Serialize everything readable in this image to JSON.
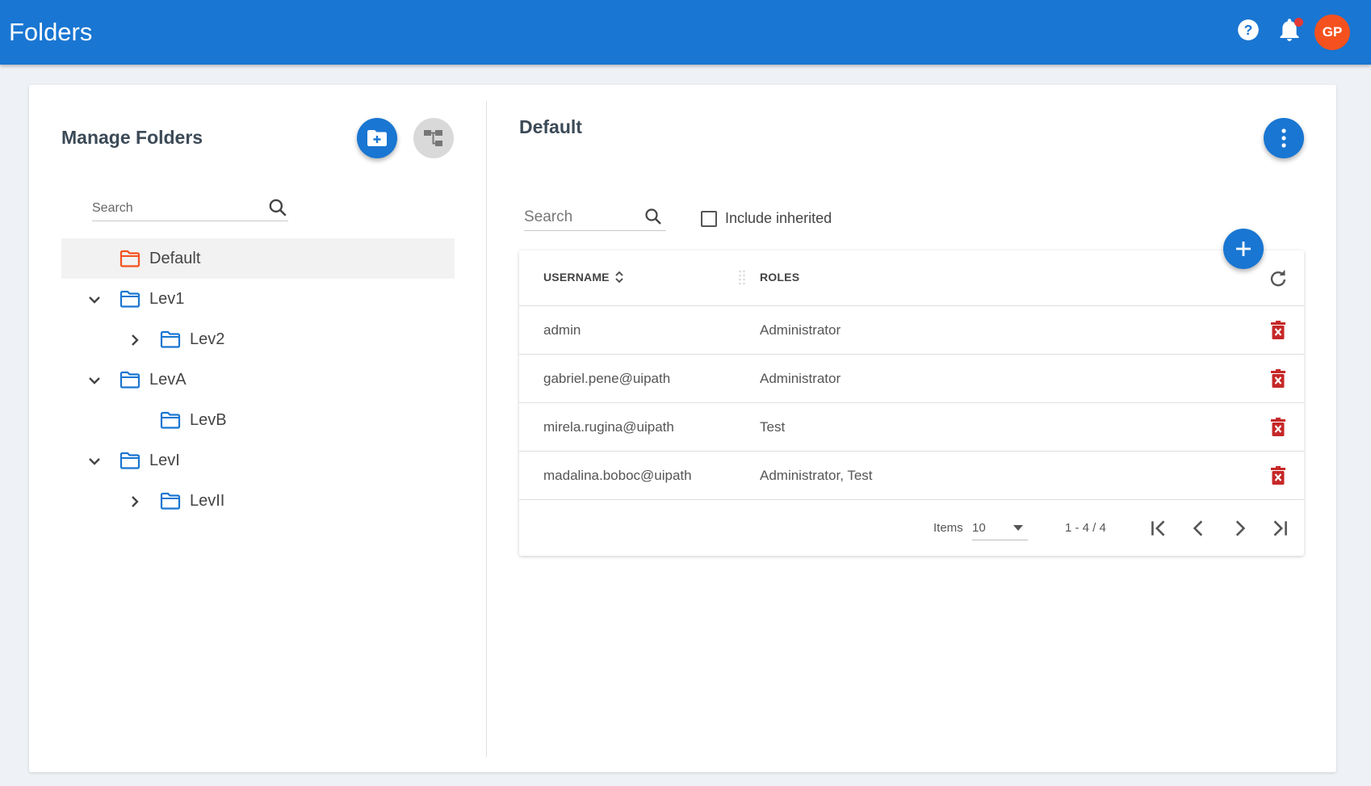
{
  "app": {
    "title": "Folders",
    "avatar_initials": "GP",
    "accent_color": "#1976d2",
    "avatar_color": "#f4511e",
    "notification_dot_color": "#e53935"
  },
  "left_panel": {
    "title": "Manage Folders",
    "search_placeholder": "Search",
    "tree": [
      {
        "label": "Default",
        "selected": true,
        "expander": "none",
        "folder_color": "#f4511e"
      },
      {
        "label": "Lev1",
        "selected": false,
        "expander": "expanded",
        "folder_color": "#1976d2"
      },
      {
        "label": "Lev2",
        "selected": false,
        "expander": "collapsed",
        "folder_color": "#1976d2"
      },
      {
        "label": "LevA",
        "selected": false,
        "expander": "expanded",
        "folder_color": "#1976d2"
      },
      {
        "label": "LevB",
        "selected": false,
        "expander": "none",
        "folder_color": "#1976d2"
      },
      {
        "label": "LevI",
        "selected": false,
        "expander": "expanded",
        "folder_color": "#1976d2"
      },
      {
        "label": "LevII",
        "selected": false,
        "expander": "collapsed",
        "folder_color": "#1976d2"
      }
    ]
  },
  "right_panel": {
    "title": "Default",
    "search_placeholder": "Search",
    "include_inherited_label": "Include inherited",
    "include_inherited_checked": false,
    "table": {
      "columns": [
        "USERNAME",
        "ROLES"
      ],
      "rows": [
        {
          "username": "admin",
          "roles": "Administrator"
        },
        {
          "username": "gabriel.pene@uipath",
          "roles": "Administrator"
        },
        {
          "username": "mirela.rugina@uipath",
          "roles": "Test"
        },
        {
          "username": "madalina.boboc@uipath",
          "roles": "Administrator, Test"
        }
      ]
    },
    "pager": {
      "items_label": "Items",
      "page_size": "10",
      "range": "1 - 4 / 4"
    }
  }
}
